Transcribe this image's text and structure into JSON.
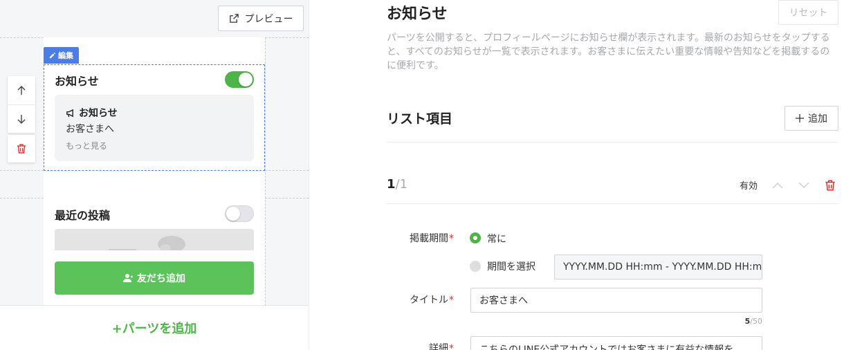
{
  "preview": {
    "preview_button_label": "プレビュー",
    "edit_tag_label": "編集",
    "notice_section": {
      "title": "お知らせ",
      "enabled": true,
      "card_heading": "お知らせ",
      "card_body": "お客さまへ",
      "card_more": "もっと見る"
    },
    "recent_posts_section": {
      "title": "最近の投稿",
      "enabled": false
    },
    "friend_button_label": "友だち追加",
    "add_parts_label": "+パーツを追加"
  },
  "settings": {
    "title": "お知らせ",
    "reset_label": "リセット",
    "description": "パーツを公開すると、プロフィールページにお知らせ欄が表示されます。最新のお知らせをタップすると、すべてのお知らせが一覧で表示されます。お客さまに伝えたい重要な情報や告知などを掲載するのに便利です。",
    "list_title": "リスト項目",
    "add_label": "追加",
    "item": {
      "index": "1",
      "total": "/1",
      "status": "有効",
      "period_label": "掲載期間",
      "period_option_always": "常に",
      "period_option_select": "期間を選択",
      "period_selected": "always",
      "period_input_placeholder": "YYYY.MM.DD HH:mm - YYYY.MM.DD HH:mm",
      "title_label": "タイトル",
      "title_value": "お客さまへ",
      "title_count": "5",
      "title_max": "/50",
      "detail_label": "詳細",
      "detail_value": "こちらのLINE公式アカウントではお客さまに有益な情報を"
    }
  },
  "colors": {
    "accent_green": "#4cb548",
    "edit_blue": "#4a7de8",
    "required_red": "#e0352c",
    "delete_red": "#e0352c"
  }
}
